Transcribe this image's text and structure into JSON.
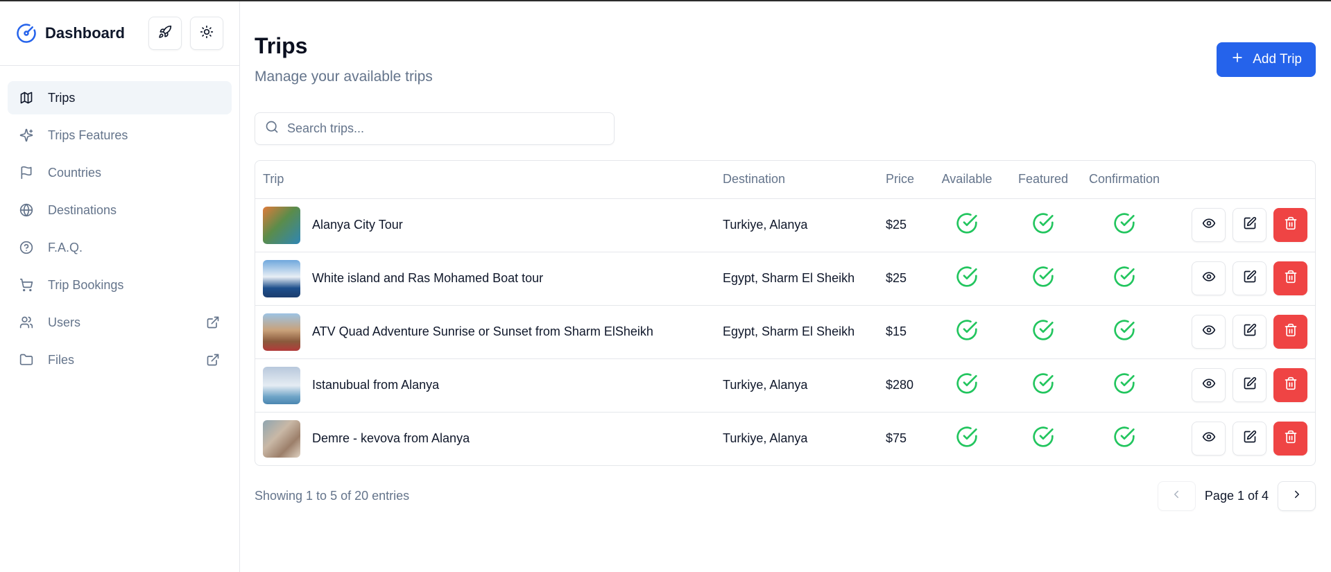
{
  "sidebar": {
    "brand": "Dashboard",
    "items": [
      {
        "label": "Trips",
        "icon": "map-icon",
        "active": true
      },
      {
        "label": "Trips Features",
        "icon": "sparkles-icon"
      },
      {
        "label": "Countries",
        "icon": "flag-icon"
      },
      {
        "label": "Destinations",
        "icon": "globe-icon"
      },
      {
        "label": "F.A.Q.",
        "icon": "help-circle-icon"
      },
      {
        "label": "Trip Bookings",
        "icon": "cart-icon"
      },
      {
        "label": "Users",
        "icon": "users-icon",
        "external": true
      },
      {
        "label": "Files",
        "icon": "folder-icon",
        "external": true
      }
    ]
  },
  "header": {
    "title": "Trips",
    "subtitle": "Manage your available trips",
    "add_label": "Add Trip"
  },
  "search": {
    "placeholder": "Search trips..."
  },
  "table": {
    "columns": [
      "Trip",
      "Destination",
      "Price",
      "Available",
      "Featured",
      "Confirmation"
    ],
    "rows": [
      {
        "trip": "Alanya City Tour",
        "destination": "Turkiye, Alanya",
        "price": "$25",
        "available": true,
        "featured": true,
        "confirmation": true
      },
      {
        "trip": "White island and Ras Mohamed Boat tour",
        "destination": "Egypt, Sharm El Sheikh",
        "price": "$25",
        "available": true,
        "featured": true,
        "confirmation": true
      },
      {
        "trip": "ATV Quad Adventure Sunrise or Sunset from Sharm ElSheikh",
        "destination": "Egypt, Sharm El Sheikh",
        "price": "$15",
        "available": true,
        "featured": true,
        "confirmation": true
      },
      {
        "trip": "Istanubual from Alanya",
        "destination": "Turkiye, Alanya",
        "price": "$280",
        "available": true,
        "featured": true,
        "confirmation": true
      },
      {
        "trip": "Demre - kevova from Alanya",
        "destination": "Turkiye, Alanya",
        "price": "$75",
        "available": true,
        "featured": true,
        "confirmation": true
      }
    ]
  },
  "footer": {
    "entries": "Showing 1 to 5 of 20 entries",
    "page_label": "Page 1 of 4"
  },
  "colors": {
    "primary": "#2563eb",
    "success": "#22c55e",
    "danger": "#ef4444",
    "muted": "#64748b"
  }
}
